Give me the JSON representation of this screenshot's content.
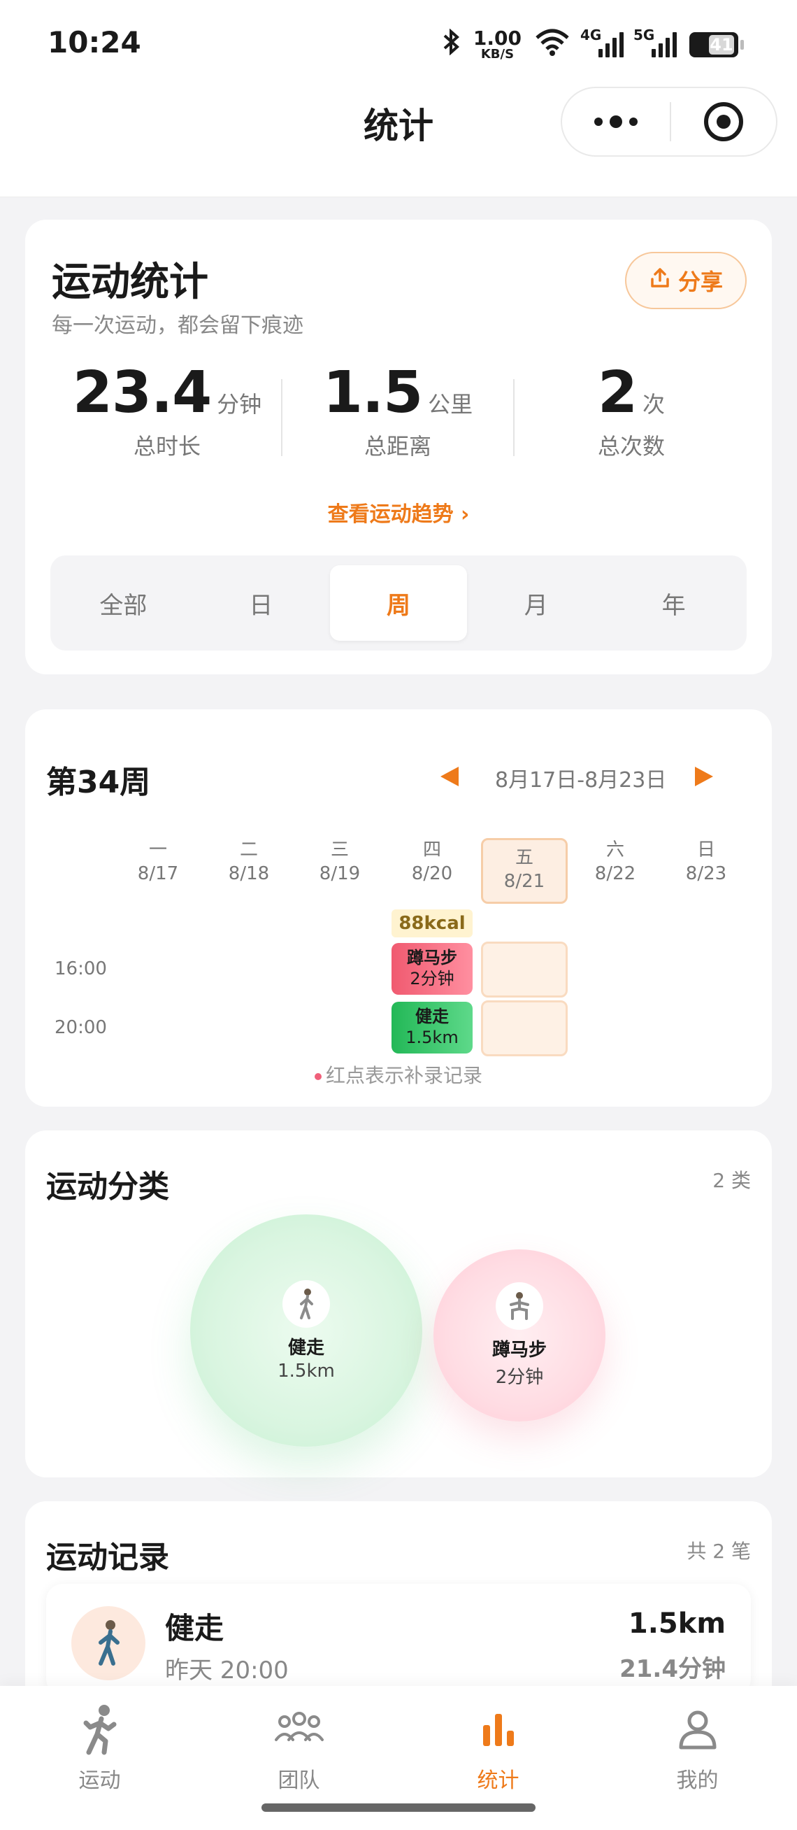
{
  "status_bar": {
    "time": "10:24",
    "net_speed_value": "1.00",
    "net_speed_unit": "KB/S",
    "sim1_label": "4G",
    "sim2_label": "5G",
    "battery": "41"
  },
  "header": {
    "title": "统计"
  },
  "stats": {
    "title": "运动统计",
    "subtitle": "每一次运动，都会留下痕迹",
    "share_label": "分享",
    "metrics": [
      {
        "value": "23.4",
        "unit": "分钟",
        "label": "总时长"
      },
      {
        "value": "1.5",
        "unit": "公里",
        "label": "总距离"
      },
      {
        "value": "2",
        "unit": "次",
        "label": "总次数"
      }
    ],
    "trend_link": "查看运动趋势 ›",
    "periods": [
      "全部",
      "日",
      "周",
      "月",
      "年"
    ],
    "active_period": "周"
  },
  "week": {
    "title": "第34周",
    "range": "8月17日-8月23日",
    "days": [
      {
        "name": "一",
        "date": "8/17"
      },
      {
        "name": "二",
        "date": "8/18"
      },
      {
        "name": "三",
        "date": "8/19"
      },
      {
        "name": "四",
        "date": "8/20"
      },
      {
        "name": "五",
        "date": "8/21"
      },
      {
        "name": "六",
        "date": "8/22"
      },
      {
        "name": "日",
        "date": "8/23"
      }
    ],
    "kcal": "88kcal",
    "times": [
      "16:00",
      "20:00"
    ],
    "events": [
      {
        "name": "蹲马步",
        "value": "2分钟"
      },
      {
        "name": "健走",
        "value": "1.5km"
      }
    ],
    "note": "红点表示补录记录"
  },
  "category": {
    "title": "运动分类",
    "count": "2 类",
    "items": [
      {
        "name": "健走",
        "value": "1.5km",
        "color": "#d9f5e0"
      },
      {
        "name": "蹲马步",
        "value": "2分钟",
        "color": "#ffdce3"
      }
    ]
  },
  "records": {
    "title": "运动记录",
    "count": "共 2 笔",
    "items": [
      {
        "name": "健走",
        "time": "昨天 20:00",
        "distance": "1.5km",
        "duration": "21.4分钟"
      }
    ]
  },
  "tabbar": {
    "tabs": [
      "运动",
      "团队",
      "统计",
      "我的"
    ],
    "active": "统计"
  },
  "colors": {
    "accent": "#ee7a1a",
    "green": "#23b857",
    "pink": "#f05a70"
  }
}
